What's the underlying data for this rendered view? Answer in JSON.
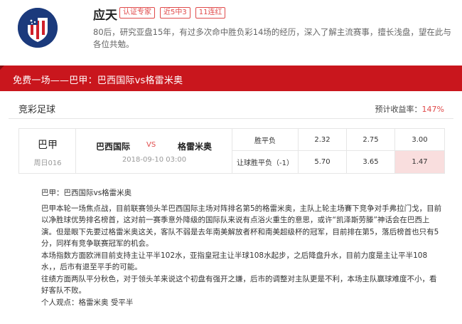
{
  "expert": {
    "name": "应天",
    "tags": [
      "认证专家",
      "近5中3",
      "11连红"
    ],
    "bio": "80后，研究亚盘15年，有过多次命中胜负彩14场的经历，深入了解主流赛事，擅长浅盘，望在此与各位共勉。",
    "avatar_icon": "club-crest-icon"
  },
  "banner": {
    "title": "免费一场——巴甲：巴西国际vs格雷米奥"
  },
  "section": {
    "title": "竞彩足球",
    "yield_label": "预计收益率：",
    "yield_value": "147%"
  },
  "match": {
    "league": "巴甲",
    "match_no": "周日016",
    "home": "巴西国际",
    "vs": "VS",
    "away": "格雷米奥",
    "time": "2018-09-10 03:00",
    "odds": [
      {
        "label": "胜平负",
        "values": [
          "2.32",
          "2.75",
          "3.00"
        ]
      },
      {
        "label": "让球胜平负（-1）",
        "values": [
          "5.70",
          "3.65",
          "1.47"
        ],
        "highlight_index": 2
      }
    ]
  },
  "analysis": {
    "heading": "巴甲：巴西国际vs格雷米奥",
    "p1": "巴甲本轮一场焦点战，目前联赛领头羊巴西国际主场对阵排名第5的格雷米奥，主队上轮主场賽下竞争对手弗拉门戈，目前以净胜球优势排名榜首，这对前一赛季意外降级的国际队来说有点浴火重生的意思，或许“凯泽斯劳滕”神话会在巴西上演。但是眼下先要过格雷米奥这关，客队不弱是去年南美解放者杯和南美超级杯的冠军，目前排在第5，落后榜首也只有5分，同样有竞争联赛冠军的机会。",
    "p2": "本场指数方面欧洲目前支持主让平半102水，亚指皇冠主让半球108水起步，之后降盘升水，目前力度是主让平半108水，，后市有退至平手的可能。",
    "p3": "往绩方面两队平分秋色，对于领头羊来说这个初盘有强开之嫌，后市的调整对主队更是不利，本场主队赢球难度不小，看好客队不败。",
    "p4": "个人观点：格雷米奥 受平半"
  },
  "colors": {
    "brand_red": "#c9161d",
    "accent_red": "#e04a4a",
    "highlight_bg": "#f9dede"
  }
}
